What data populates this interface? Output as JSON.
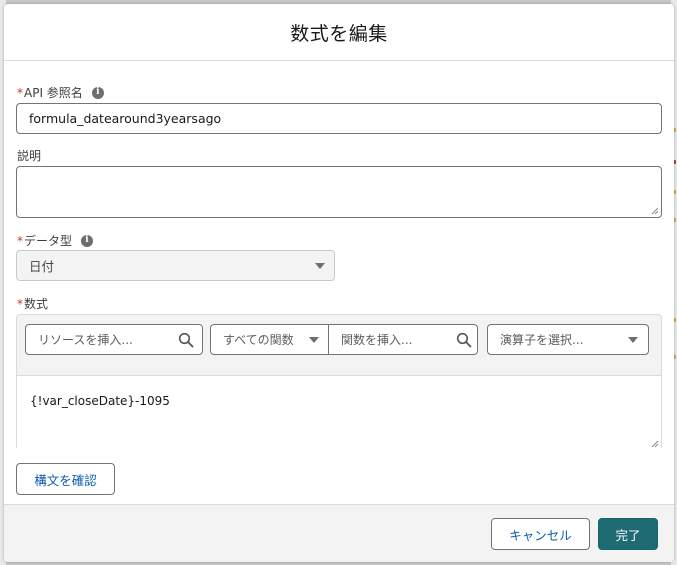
{
  "modal": {
    "title": "数式を編集"
  },
  "fields": {
    "api_name": {
      "required_mark": "*",
      "label": "API 参照名",
      "value": "formula_datearound3yearsago"
    },
    "description": {
      "label": "説明",
      "value": ""
    },
    "data_type": {
      "required_mark": "*",
      "label": "データ型",
      "value": "日付"
    },
    "formula": {
      "required_mark": "*",
      "label": "数式",
      "resource_search_placeholder": "リソースを挿入...",
      "function_category": "すべての関数",
      "function_search_placeholder": "関数を挿入...",
      "operator_placeholder": "演算子を選択...",
      "value": "{!var_closeDate}-1095"
    }
  },
  "buttons": {
    "check_syntax": "構文を確認",
    "cancel": "キャンセル",
    "done": "完了"
  },
  "icons": {
    "info": "info-icon",
    "search": "search-icon",
    "caret": "chevron-down-icon"
  },
  "colors": {
    "brand": "#1f6b74",
    "link": "#0b5cab",
    "required": "#c23934"
  }
}
